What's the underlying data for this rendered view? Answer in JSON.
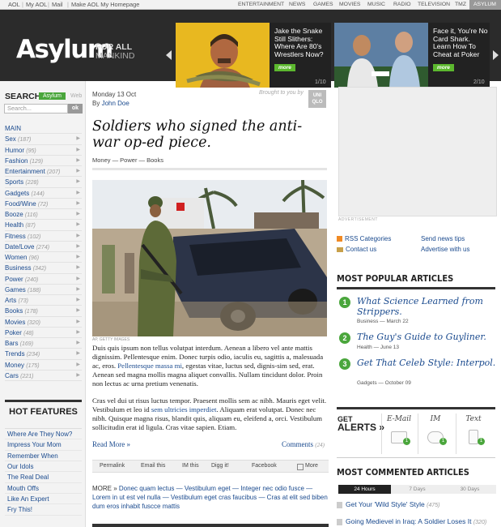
{
  "topbar": {
    "left_links": [
      "AOL",
      "My AOL",
      "Mail",
      "Make AOL My Homepage"
    ],
    "right_links": [
      "ENTERTAINMENT",
      "NEWS",
      "GAMES",
      "MOVIES",
      "MUSIC",
      "RADIO",
      "TELEVISION",
      "TMZ",
      "ASYLUM"
    ],
    "active": "ASYLUM"
  },
  "masthead": {
    "logo": "Asylum",
    "tagline_1": "FOR ALL",
    "tagline_2": "MANKIND",
    "promos": [
      {
        "title": "Jake the Snake Still Slithers: Where Are 80's Wrestlers Now?",
        "more": "more",
        "pager": "1/10"
      },
      {
        "title": "Face it, You're No Card Shark. Learn How To Cheat at Poker",
        "more": "more",
        "pager": "2/10"
      }
    ]
  },
  "search": {
    "title": "SEARCH",
    "tab_active": "Asylum",
    "tab_other": "Web",
    "placeholder": "Search...",
    "button": "ok"
  },
  "nav": [
    {
      "label": "MAIN",
      "count": ""
    },
    {
      "label": "Sex",
      "count": "(187)"
    },
    {
      "label": "Humor",
      "count": "(95)"
    },
    {
      "label": "Fashion",
      "count": "(129)"
    },
    {
      "label": "Entertainment",
      "count": "(207)"
    },
    {
      "label": "Sports",
      "count": "(228)"
    },
    {
      "label": "Gadgets",
      "count": "(144)"
    },
    {
      "label": "Food/Wine",
      "count": "(72)"
    },
    {
      "label": "Booze",
      "count": "(116)"
    },
    {
      "label": "Health",
      "count": "(87)"
    },
    {
      "label": "Fitness",
      "count": "(102)"
    },
    {
      "label": "Date/Love",
      "count": "(274)"
    },
    {
      "label": "Women",
      "count": "(96)"
    },
    {
      "label": "Business",
      "count": "(342)"
    },
    {
      "label": "Power",
      "count": "(240)"
    },
    {
      "label": "Games",
      "count": "(188)"
    },
    {
      "label": "Arts",
      "count": "(73)"
    },
    {
      "label": "Books",
      "count": "(178)"
    },
    {
      "label": "Movies",
      "count": "(320)"
    },
    {
      "label": "Poker",
      "count": "(48)"
    },
    {
      "label": "Bars",
      "count": "(169)"
    },
    {
      "label": "Trends",
      "count": "(234)"
    },
    {
      "label": "Money",
      "count": "(175)"
    },
    {
      "label": "Cars",
      "count": "(221)"
    }
  ],
  "hot_features": {
    "title": "HOT FEATURES",
    "items": [
      "Where Are They Now?",
      "Impress Your Mom",
      "Remember When",
      "Our Idols",
      "The Real Deal",
      "Mouth Offs",
      "Like An Expert",
      "Fry This!"
    ]
  },
  "article": {
    "date": "Monday 13 Oct",
    "by": "By",
    "author": "John Doe",
    "brought": "Brought to you by",
    "sponsor": "UNI QLO",
    "title": "Soldiers who signed the anti-war op-ed piece.",
    "tags": "Money — Power — Books",
    "credit": "AP, GETTY IMAGES",
    "p1_a": "Duis quis ipsum non tellus volutpat interdum. Aenean a libero vel ante mattis dignissim. Pellentesque enim. Donec turpis odio, iaculis eu, sagittis a, malesuada ac, eros. ",
    "p1_link": "Pellentesque massa mi",
    "p1_b": ", egestas vitae, luctus sed, dignis-sim sed, erat. Aenean sed magna mollis magna aliquet convallis. Nullam tincidunt dolor. Proin non lectus ac urna pretium venenatis.",
    "p2_a": "Cras vel dui ut risus luctus tempor. Praesent mollis sem ac nibh. Mauris eget velit. Vestibulum et leo id ",
    "p2_link": "sem ultricies imperdiet",
    "p2_b": ". Aliquam erat volutpat. Donec nec nibh. Quisque magna risus, blandit quis, aliquam eu, eleifend a, orci. Vestibulum sollicitudin erat id ligula. Cras vitae sapien. Etiam.",
    "read_more": "Read More »",
    "comments": "Comments",
    "comments_count": "(24)",
    "share": [
      "Permalink",
      "Email this",
      "IM this",
      "Digg it!",
      "Facebook",
      "More"
    ],
    "more_label": "MORE »",
    "more_links": "Donec quam lectus — Vestibulum eget — Integer nec odio fusce — Lorem in ut est vel nulla — Vestibulum eget cras faucibus — Cras at elit sed biben dum eros inhabit fuscce mattis"
  },
  "right": {
    "ad_label": "ADVERTISEMENT",
    "links": [
      "RSS Categories",
      "Send news tips",
      "Contact us",
      "Advertise with us"
    ],
    "popular_title": "MOST POPULAR ARTICLES",
    "popular": [
      {
        "n": "1",
        "title": "What Science Learned from Strippers.",
        "meta": "Business — March 22"
      },
      {
        "n": "2",
        "title": "The Guy's Guide to Guyliner.",
        "meta": "Health — June 13"
      },
      {
        "n": "3",
        "title": "Get That Celeb Style: Interpol.",
        "meta": "Gadgets — October 09"
      }
    ],
    "alerts_get": "GET",
    "alerts_label": "ALERTS »",
    "alerts": [
      {
        "label": "E-Mail",
        "badge": "1"
      },
      {
        "label": "IM",
        "badge": "1"
      },
      {
        "label": "Text",
        "badge": "1"
      }
    ],
    "commented_title": "MOST COMMENTED ARTICLES",
    "tabs": [
      "24 Hours",
      "7 Days",
      "30 Days"
    ],
    "commented": [
      {
        "title": "Get Your 'Wild Style' Style",
        "count": "(475)"
      },
      {
        "title": "Going Medievel in Iraq: A Soldier Loses It",
        "count": "(320)"
      }
    ]
  }
}
